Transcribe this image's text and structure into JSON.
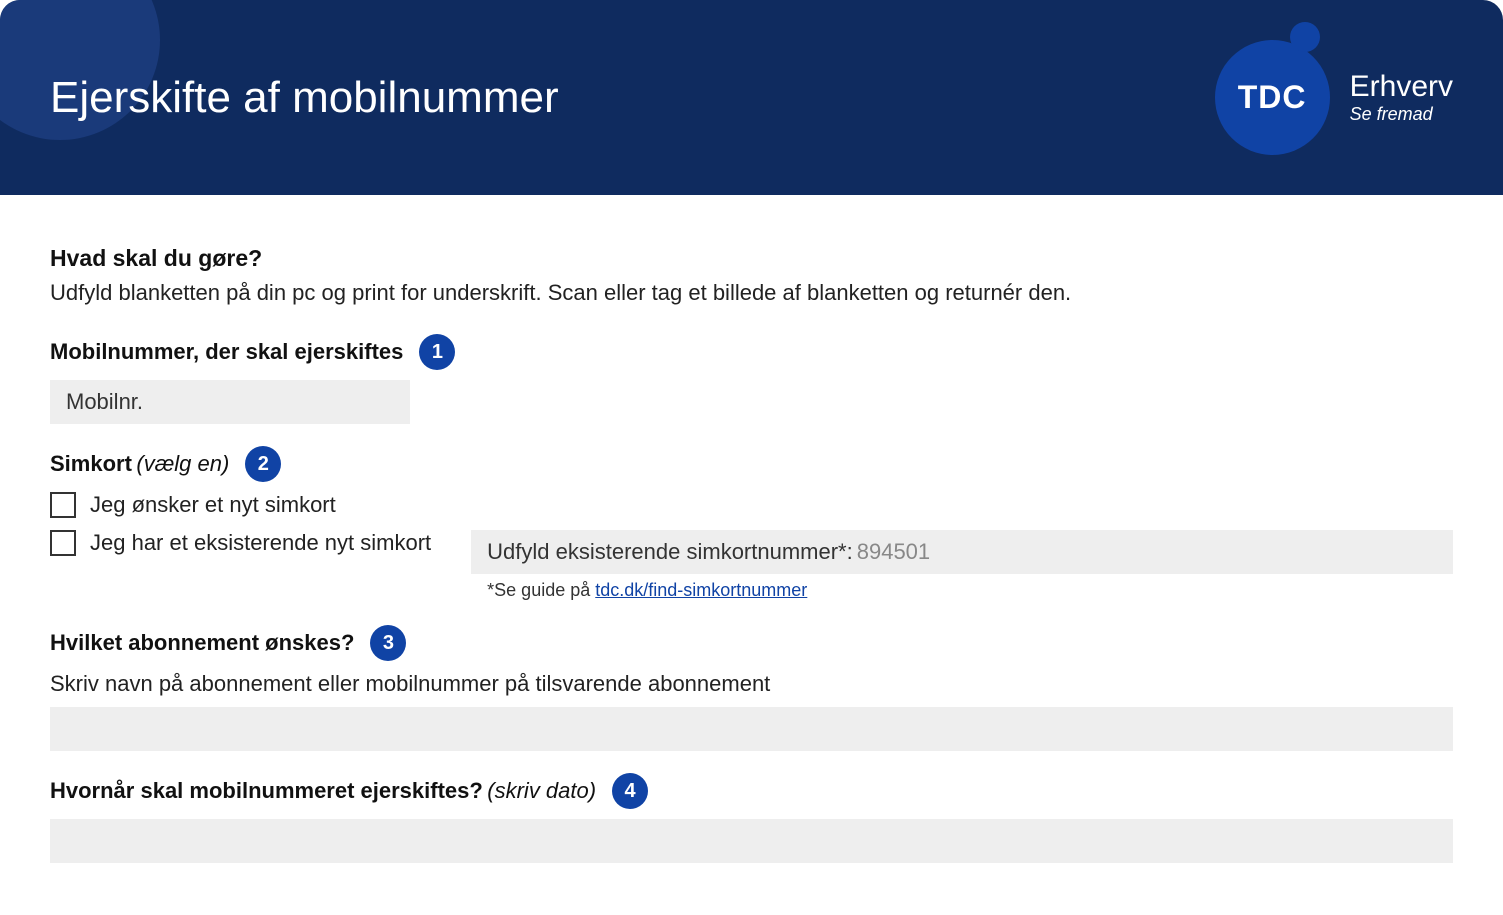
{
  "header": {
    "title": "Ejerskifte af mobilnummer",
    "logo_tdc": "TDC",
    "logo_brand": "Erhverv",
    "logo_tagline": "Se fremad"
  },
  "intro": {
    "heading": "Hvad skal du gøre?",
    "text": "Udfyld blanketten på din pc og print for underskrift. Scan eller tag et billede af blanketten og returnér den."
  },
  "section1": {
    "heading": "Mobilnummer, der skal ejerskiftes",
    "step": "1",
    "placeholder": "Mobilnr."
  },
  "section2": {
    "heading": "Simkort",
    "subheading": "(vælg en)",
    "step": "2",
    "option_new": "Jeg ønsker et nyt simkort",
    "option_existing": "Jeg har et eksisterende nyt simkort",
    "sim_input_label": "Udfyld eksisterende simkortnummer*: ",
    "sim_input_value": "894501",
    "guide_prefix": "*Se guide på ",
    "guide_link": "tdc.dk/find-simkortnummer"
  },
  "section3": {
    "heading": "Hvilket abonnement ønskes?",
    "step": "3",
    "subtext": "Skriv navn på abonnement eller mobilnummer på tilsvarende abonnement"
  },
  "section4": {
    "heading": "Hvornår skal mobilnummeret ejerskiftes?",
    "subheading": "(skriv dato)",
    "step": "4"
  }
}
